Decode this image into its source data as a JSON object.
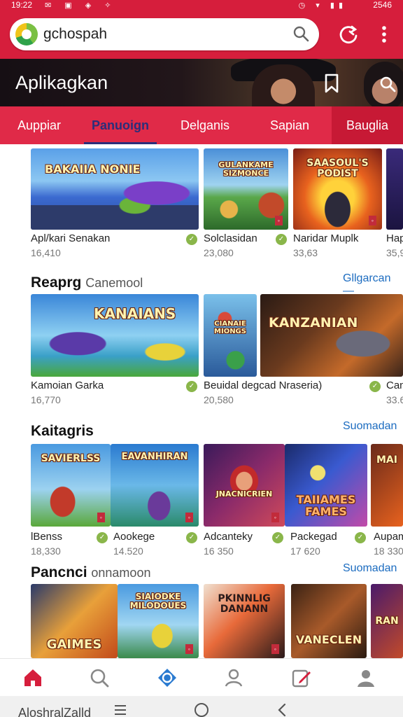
{
  "status": {
    "time": "19:22",
    "right": "2546"
  },
  "search": {
    "query": "gchospah"
  },
  "banner": {
    "title": "Aplikagkan"
  },
  "tabs": [
    {
      "label": "Auppiar"
    },
    {
      "label": "Panuoign"
    },
    {
      "label": "Delganis"
    },
    {
      "label": "Sapian"
    },
    {
      "label": "Bauglia"
    }
  ],
  "row1": [
    {
      "name": "Apl/kari Senakan",
      "count": "16,410",
      "art": "BAKAIIA NONIE"
    },
    {
      "name": "Solclasidan",
      "count": "23,080",
      "art": "GULANKAME SIZMONCE"
    },
    {
      "name": "Naridar Muplk",
      "count": "33,63",
      "art": "SAASOUL'S PODIST"
    },
    {
      "name": "Hap",
      "count": "35,9",
      "art": ""
    }
  ],
  "section2": {
    "title": "Reaprg",
    "subtitle": "Canemool",
    "see_all": "Gllgarcan —"
  },
  "row2": [
    {
      "name": "Kamoian Garka",
      "count": "16,770",
      "art": "KANAIANS"
    },
    {
      "name": "Beuidal degcad Nraseria)",
      "count": "20,580",
      "art": "CIANAIE MIONGS"
    },
    {
      "name": "Can",
      "count": "33.6",
      "art": "KANZANIAN"
    }
  ],
  "section3": {
    "title": "Kaitagris",
    "see_all": "Suomadan"
  },
  "row3": [
    {
      "name": "lBenss",
      "count": "18,330",
      "art": "SAVIERLSS"
    },
    {
      "name": "Aookege",
      "count": "14.520",
      "art": "EAVANHIRAN"
    },
    {
      "name": "Adcanteky",
      "count": "16 350",
      "art": "JNACNICRIEN"
    },
    {
      "name": "Packegad",
      "count": "17 620",
      "art": "TAIIAMES FAMES"
    },
    {
      "name": "Aupam",
      "count": "18 330",
      "art": "MAI"
    }
  ],
  "section4": {
    "title": "Pancnci",
    "subtitle": "onnamoon",
    "see_all": "Suomadan"
  },
  "row4": [
    {
      "art": "GAIMES"
    },
    {
      "art": "SIAIODKE MILODOUES"
    },
    {
      "art": "PKINNLIG DANANN"
    },
    {
      "art": "VANECLEN"
    },
    {
      "art": "RAN"
    }
  ],
  "system": {
    "label": "AloshralZalld"
  },
  "colors": {
    "brand": "#d61e3c",
    "tab_bg": "#e02a48",
    "link": "#1c6cc0",
    "active_tab": "#2b2e7a"
  },
  "icons": [
    "search-icon",
    "refresh-icon",
    "more-vert-icon",
    "bookmark-icon",
    "home-icon",
    "compass-icon",
    "apps-icon",
    "profile-icon",
    "edit-icon",
    "account-icon"
  ]
}
